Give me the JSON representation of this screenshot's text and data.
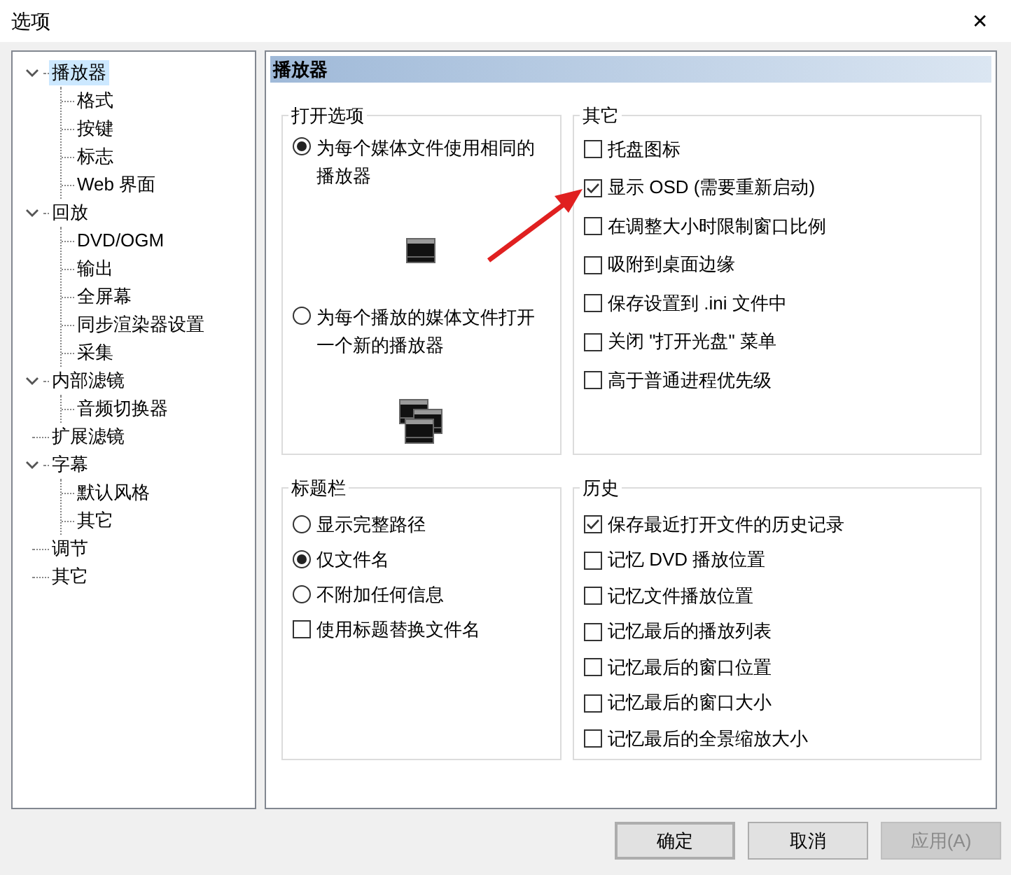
{
  "window": {
    "title": "选项",
    "close": "✕"
  },
  "tree": [
    {
      "label": "播放器",
      "selected": true,
      "expanded": true,
      "children": [
        {
          "label": "格式",
          "selected": false
        },
        {
          "label": "按键",
          "selected": false
        },
        {
          "label": "标志",
          "selected": false
        },
        {
          "label": "Web 界面",
          "selected": false
        }
      ]
    },
    {
      "label": "回放",
      "selected": false,
      "expanded": true,
      "children": [
        {
          "label": "DVD/OGM",
          "selected": false
        },
        {
          "label": "输出",
          "selected": false
        },
        {
          "label": "全屏幕",
          "selected": false
        },
        {
          "label": "同步渲染器设置",
          "selected": false
        },
        {
          "label": "采集",
          "selected": false
        }
      ]
    },
    {
      "label": "内部滤镜",
      "selected": false,
      "expanded": true,
      "children": [
        {
          "label": "音频切换器",
          "selected": false
        }
      ]
    },
    {
      "label": "扩展滤镜",
      "selected": false
    },
    {
      "label": "字幕",
      "selected": false,
      "expanded": true,
      "children": [
        {
          "label": "默认风格",
          "selected": false
        },
        {
          "label": "其它",
          "selected": false
        }
      ]
    },
    {
      "label": "调节",
      "selected": false
    },
    {
      "label": "其它",
      "selected": false
    }
  ],
  "page_header": "播放器",
  "open_options": {
    "title": "打开选项",
    "options": [
      {
        "label": "为每个媒体文件使用相同的播放器",
        "selected": true,
        "kind": "single"
      },
      {
        "label": "为每个播放的媒体文件打开一个新的播放器",
        "selected": false,
        "kind": "multiple"
      }
    ]
  },
  "other": {
    "title": "其它",
    "items": [
      {
        "label": "托盘图标",
        "checked": false
      },
      {
        "label": "显示 OSD (需要重新启动)",
        "checked": true
      },
      {
        "label": "在调整大小时限制窗口比例",
        "checked": false
      },
      {
        "label": "吸附到桌面边缘",
        "checked": false
      },
      {
        "label": "保存设置到 .ini 文件中",
        "checked": false
      },
      {
        "label": "关闭 \"打开光盘\" 菜单",
        "checked": false
      },
      {
        "label": "高于普通进程优先级",
        "checked": false
      }
    ]
  },
  "title_bar": {
    "title": "标题栏",
    "items": [
      {
        "kind": "radio",
        "label": "显示完整路径",
        "selected": false
      },
      {
        "kind": "radio",
        "label": "仅文件名",
        "selected": true
      },
      {
        "kind": "radio",
        "label": "不附加任何信息",
        "selected": false
      },
      {
        "kind": "checkbox",
        "label": "使用标题替换文件名",
        "checked": false
      }
    ]
  },
  "history": {
    "title": "历史",
    "items": [
      {
        "label": "保存最近打开文件的历史记录",
        "checked": true
      },
      {
        "label": "记忆 DVD 播放位置",
        "checked": false
      },
      {
        "label": "记忆文件播放位置",
        "checked": false
      },
      {
        "label": "记忆最后的播放列表",
        "checked": false
      },
      {
        "label": "记忆最后的窗口位置",
        "checked": false
      },
      {
        "label": "记忆最后的窗口大小",
        "checked": false
      },
      {
        "label": "记忆最后的全景缩放大小",
        "checked": false
      }
    ]
  },
  "buttons": [
    {
      "label": "确定",
      "disabled": false,
      "default": true
    },
    {
      "label": "取消",
      "disabled": false,
      "default": false
    },
    {
      "label": "应用(A)",
      "disabled": true,
      "default": false
    }
  ]
}
